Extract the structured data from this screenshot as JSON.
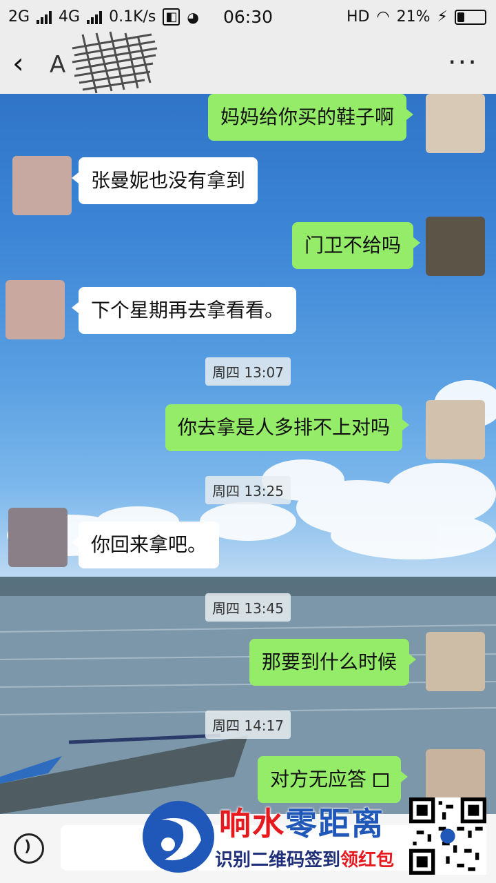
{
  "status_bar": {
    "net1": "2G",
    "net2": "4G",
    "speed": "0.1K/s",
    "time": "06:30",
    "hd": "HD",
    "battery": "21%"
  },
  "nav": {
    "title": "A",
    "back_icon": "chevron-left-icon",
    "more_icon": "more-icon",
    "more": "···"
  },
  "messages": [
    {
      "side": "me",
      "text": "妈妈给你买的鞋子啊"
    },
    {
      "side": "other",
      "text": "张曼妮也没有拿到"
    },
    {
      "side": "me",
      "text": "门卫不给吗"
    },
    {
      "side": "other",
      "text": "下个星期再去拿看看。"
    },
    {
      "side": "time",
      "text": "周四 13:07"
    },
    {
      "side": "me",
      "text": "你去拿是人多排不上对吗"
    },
    {
      "side": "time",
      "text": "周四 13:25"
    },
    {
      "side": "other",
      "text": "你回来拿吧。"
    },
    {
      "side": "time",
      "text": "周四 13:45"
    },
    {
      "side": "me",
      "text": "那要到什么时候"
    },
    {
      "side": "time",
      "text": "周四 14:17"
    },
    {
      "side": "me",
      "text": "对方无应答"
    }
  ],
  "watermark": {
    "title_part1": "响水",
    "title_part2": "零距离",
    "subtitle_part1": "识别二维码签到",
    "subtitle_part2": "领红包"
  },
  "colors": {
    "me_bubble": "#95ec69",
    "other_bubble": "#ffffff",
    "watermark_red": "#e6191e",
    "watermark_blue": "#1f58b8"
  }
}
